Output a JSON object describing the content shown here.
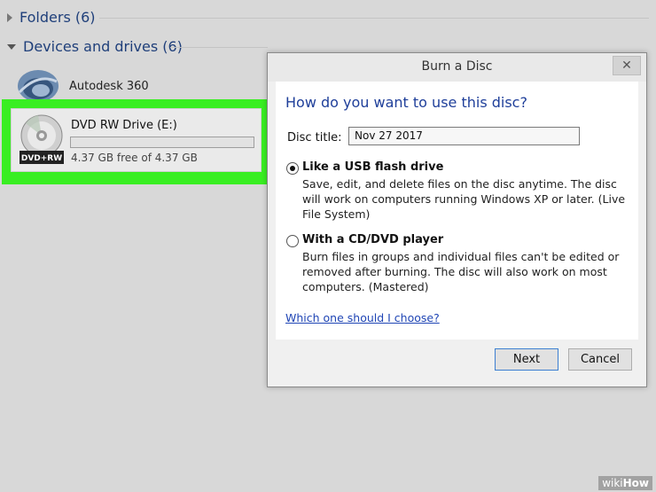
{
  "explorer": {
    "folders_label": "Folders (6)",
    "devices_label": "Devices and drives (6)",
    "autodesk_label": "Autodesk 360",
    "drive": {
      "title": "DVD RW Drive (E:)",
      "free_text": "4.37 GB free of 4.37 GB",
      "usage_fraction": 0.0,
      "icon_label": "DVD+RW"
    }
  },
  "dialog": {
    "title": "Burn a Disc",
    "close_symbol": "✕",
    "heading": "How do you want to use this disc?",
    "disc_title_label": "Disc title:",
    "disc_title_value": "Nov 27 2017",
    "options": [
      {
        "title": "Like a USB flash drive",
        "description": "Save, edit, and delete files on the disc anytime. The disc will work on computers running Windows XP or later. (Live File System)",
        "checked": true
      },
      {
        "title": "With a CD/DVD player",
        "description": "Burn files in groups and individual files can't be edited or removed after burning. The disc will also work on most computers. (Mastered)",
        "checked": false
      }
    ],
    "help_link": "Which one should I choose?",
    "next_label": "Next",
    "cancel_label": "Cancel"
  },
  "watermark": {
    "wiki": "wiki",
    "how": "How"
  },
  "colors": {
    "highlight": "#39ee22",
    "heading": "#1f3f9a",
    "link": "#1f45b5"
  }
}
